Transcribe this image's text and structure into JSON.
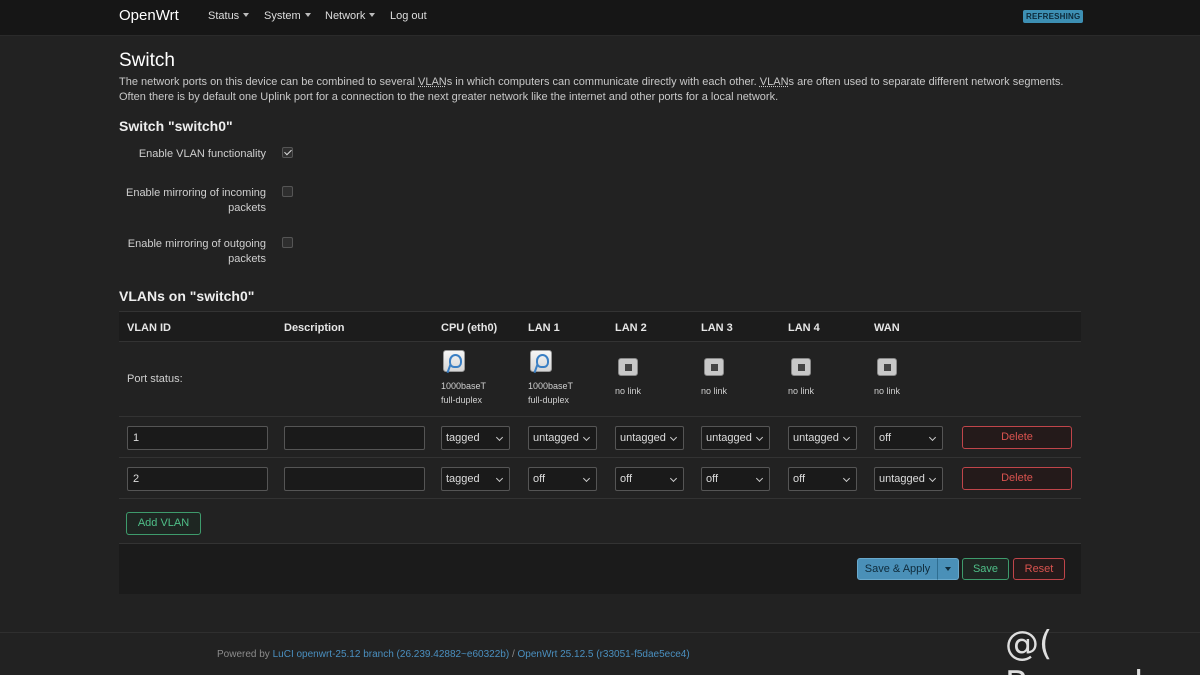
{
  "nav": {
    "brand": "OpenWrt",
    "items": [
      {
        "label": "Status",
        "dropdown": true
      },
      {
        "label": "System",
        "dropdown": true
      },
      {
        "label": "Network",
        "dropdown": true
      },
      {
        "label": "Log out",
        "dropdown": false
      }
    ],
    "badge": "REFRESHING"
  },
  "page": {
    "title": "Switch",
    "desc_1": "The network ports on this device can be combined to several ",
    "abbr_1": "VLAN",
    "desc_2": "s in which computers can communicate directly with each other. ",
    "abbr_2": "VLAN",
    "desc_3": "s are often used to separate different network segments. Often there is by default one Uplink port for a connection to the next greater network like the internet and other ports for a local network."
  },
  "switch_section": {
    "title": "Switch \"switch0\"",
    "options": [
      {
        "label": "Enable VLAN functionality",
        "checked": true
      },
      {
        "label": "Enable mirroring of incoming packets",
        "checked": false
      },
      {
        "label": "Enable mirroring of outgoing packets",
        "checked": false
      }
    ]
  },
  "vlan_section": {
    "title": "VLANs on \"switch0\"",
    "columns": [
      "VLAN ID",
      "Description",
      "CPU (eth0)",
      "LAN 1",
      "LAN 2",
      "LAN 3",
      "LAN 4",
      "WAN"
    ],
    "port_status_label": "Port status:",
    "ports": [
      {
        "icon": "port-up-icon",
        "status": "1000baseT\nfull-duplex"
      },
      {
        "icon": "port-up-icon",
        "status": "1000baseT\nfull-duplex"
      },
      {
        "icon": "port-down-icon",
        "status": "no link"
      },
      {
        "icon": "port-down-icon",
        "status": "no link"
      },
      {
        "icon": "port-down-icon",
        "status": "no link"
      },
      {
        "icon": "port-down-icon",
        "status": "no link"
      }
    ],
    "rows": [
      {
        "vlan_id": "1",
        "description": "",
        "ports": [
          "tagged",
          "untagged",
          "untagged",
          "untagged",
          "untagged",
          "off"
        ],
        "delete_label": "Delete"
      },
      {
        "vlan_id": "2",
        "description": "",
        "ports": [
          "tagged",
          "off",
          "off",
          "off",
          "off",
          "untagged"
        ],
        "delete_label": "Delete"
      }
    ],
    "add_label": "Add VLAN"
  },
  "actions": {
    "save_apply": "Save & Apply",
    "save": "Save",
    "reset": "Reset"
  },
  "footer": {
    "powered_by": "Powered by ",
    "luci_link": "LuCI openwrt-25.12 branch (26.239.42882~e60322b)",
    "separator": " / ",
    "openwrt_link": "OpenWrt 25.12.5 (r33051-f5dae5ece4)"
  },
  "watermark": "@( Bazos.sk"
}
